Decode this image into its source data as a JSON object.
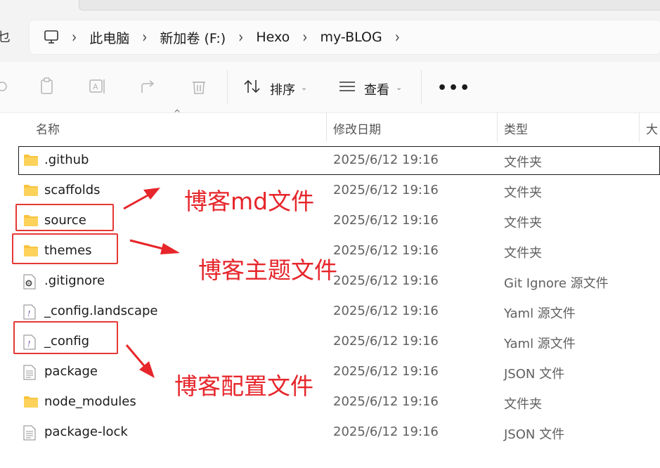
{
  "window": {
    "left_char": "乜"
  },
  "breadcrumb": {
    "items": [
      {
        "label": "此电脑"
      },
      {
        "label": "新加卷 (F:)"
      },
      {
        "label": "Hexo"
      },
      {
        "label": "my-BLOG"
      }
    ]
  },
  "toolbar": {
    "sort_label": "排序",
    "view_label": "查看",
    "more_label": "•••"
  },
  "columns": {
    "name": "名称",
    "modified": "修改日期",
    "type": "类型",
    "size": "大"
  },
  "files": [
    {
      "name": ".github",
      "modified": "2025/6/12 19:16",
      "type": "文件夹",
      "icon": "folder-icon"
    },
    {
      "name": "scaffolds",
      "modified": "2025/6/12 19:16",
      "type": "文件夹",
      "icon": "folder-icon"
    },
    {
      "name": "source",
      "modified": "2025/6/12 19:16",
      "type": "文件夹",
      "icon": "folder-icon"
    },
    {
      "name": "themes",
      "modified": "2025/6/12 19:16",
      "type": "文件夹",
      "icon": "folder-icon"
    },
    {
      "name": ".gitignore",
      "modified": "2025/6/12 19:16",
      "type": "Git Ignore 源文件",
      "icon": "gear-file-icon"
    },
    {
      "name": "_config.landscape",
      "modified": "2025/6/12 19:16",
      "type": "Yaml 源文件",
      "icon": "yaml-file-icon"
    },
    {
      "name": "_config",
      "modified": "2025/6/12 19:16",
      "type": "Yaml 源文件",
      "icon": "yaml-file-icon"
    },
    {
      "name": "package",
      "modified": "2025/6/12 19:16",
      "type": "JSON 文件",
      "icon": "json-file-icon"
    },
    {
      "name": "node_modules",
      "modified": "2025/6/12 19:16",
      "type": "文件夹",
      "icon": "folder-icon"
    },
    {
      "name": "package-lock",
      "modified": "2025/6/12 19:16",
      "type": "JSON 文件",
      "icon": "json-file-icon"
    }
  ],
  "annotations": {
    "md_files": "博客md文件",
    "theme_files": "博客主题文件",
    "config_files": "博客配置文件",
    "color": "#e6262b"
  }
}
